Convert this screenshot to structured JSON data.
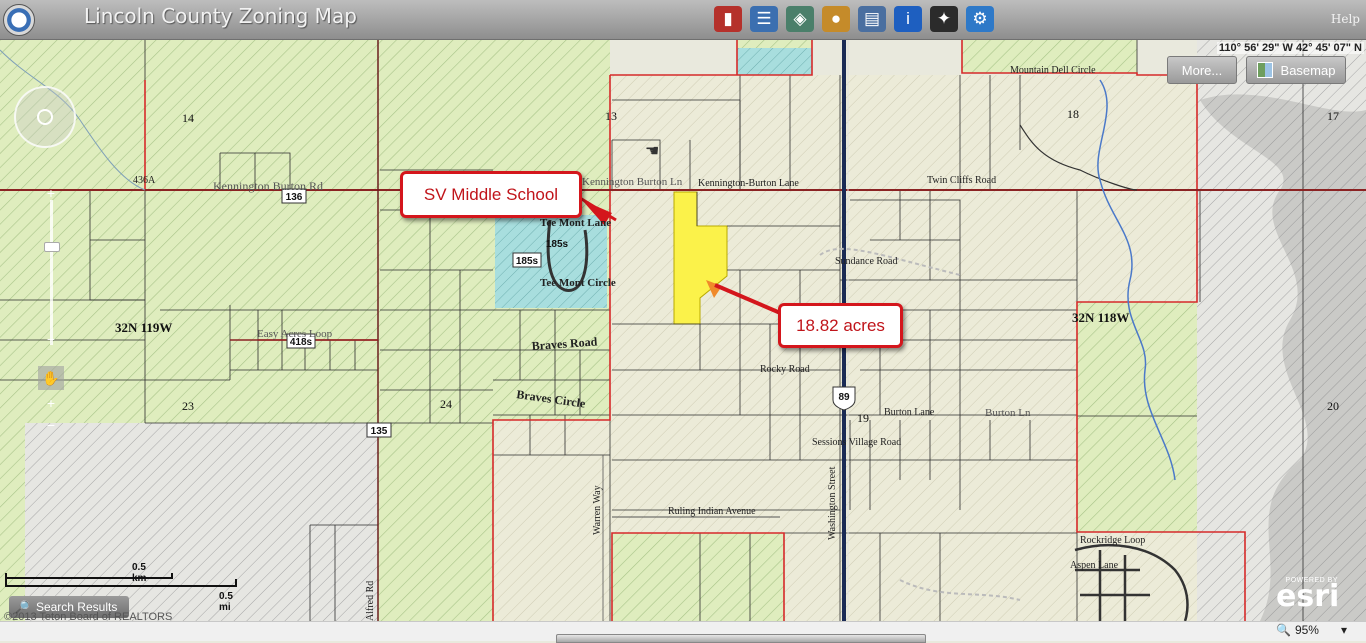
{
  "app": {
    "title": "Lincoln County Zoning Map",
    "help": "Help"
  },
  "toolbar": {
    "tools": [
      {
        "name": "legend-book-icon",
        "glyph": "▮",
        "color": "#b5312b"
      },
      {
        "name": "layer-list-icon",
        "glyph": "☰",
        "color": "#3b6fb0"
      },
      {
        "name": "basemap-layers-icon",
        "glyph": "◈",
        "color": "#4a7f6a"
      },
      {
        "name": "palette-icon",
        "glyph": "●",
        "color": "#c58b2a"
      },
      {
        "name": "print-icon",
        "glyph": "▤",
        "color": "#4a6fa0"
      },
      {
        "name": "info-icon",
        "glyph": "i",
        "color": "#1e5fc0"
      },
      {
        "name": "measure-icon",
        "glyph": "✦",
        "color": "#2b2b2b"
      },
      {
        "name": "tools-icon",
        "glyph": "⚙",
        "color": "#2e79c8"
      }
    ]
  },
  "map_controls": {
    "coordinates": "110° 56' 29\" W 42° 45' 07\" N",
    "more_button": "More...",
    "basemap_button": "Basemap"
  },
  "labels": {
    "sections": [
      "14",
      "13",
      "18",
      "17",
      "23",
      "24",
      "19",
      "20"
    ],
    "townships": [
      "32N 119W",
      "32N 118W"
    ],
    "highways": [
      "136",
      "418s",
      "135",
      "89",
      "185s",
      "185s"
    ],
    "roads": [
      "Kennington Burton Rd",
      "436A",
      "Kennington Burton Ln",
      "Kennington-Burton Lane",
      "Twin Cliffs Road",
      "Mountain Dell Circle",
      "Tee Mont Lane",
      "Tee Mont Circle",
      "Easy Acres Loop",
      "Braves Road",
      "Braves Circle",
      "Sundance Road",
      "Rocky Road",
      "Burton Lane",
      "Burton Ln",
      "Sessions Village Road",
      "Ruling Indian Avenue",
      "Warren Way",
      "Washington Street",
      "Aspen Lane",
      "Rockridge Loop",
      "Alfred Rd"
    ]
  },
  "annotations": {
    "school_callout": "SV Middle School",
    "acres_callout": "18.82 acres"
  },
  "scale": {
    "km": "0.5 km",
    "mi": "0.5 mi"
  },
  "bottom": {
    "search_results": "Search Results",
    "copyright": "©2013 Teton Board of REALTORS",
    "powered_by": "POWERED BY",
    "esri": "esri",
    "zoom": "95%"
  },
  "colors": {
    "zone_green": "#dfedbe",
    "zone_tan": "#ecebd8",
    "parcel_line": "#2e2e2e",
    "boundary_red": "#d62a2a",
    "highlight_yellow": "#fbf24a",
    "school_blue": "#a8dede",
    "callout_red": "#d4161c"
  }
}
